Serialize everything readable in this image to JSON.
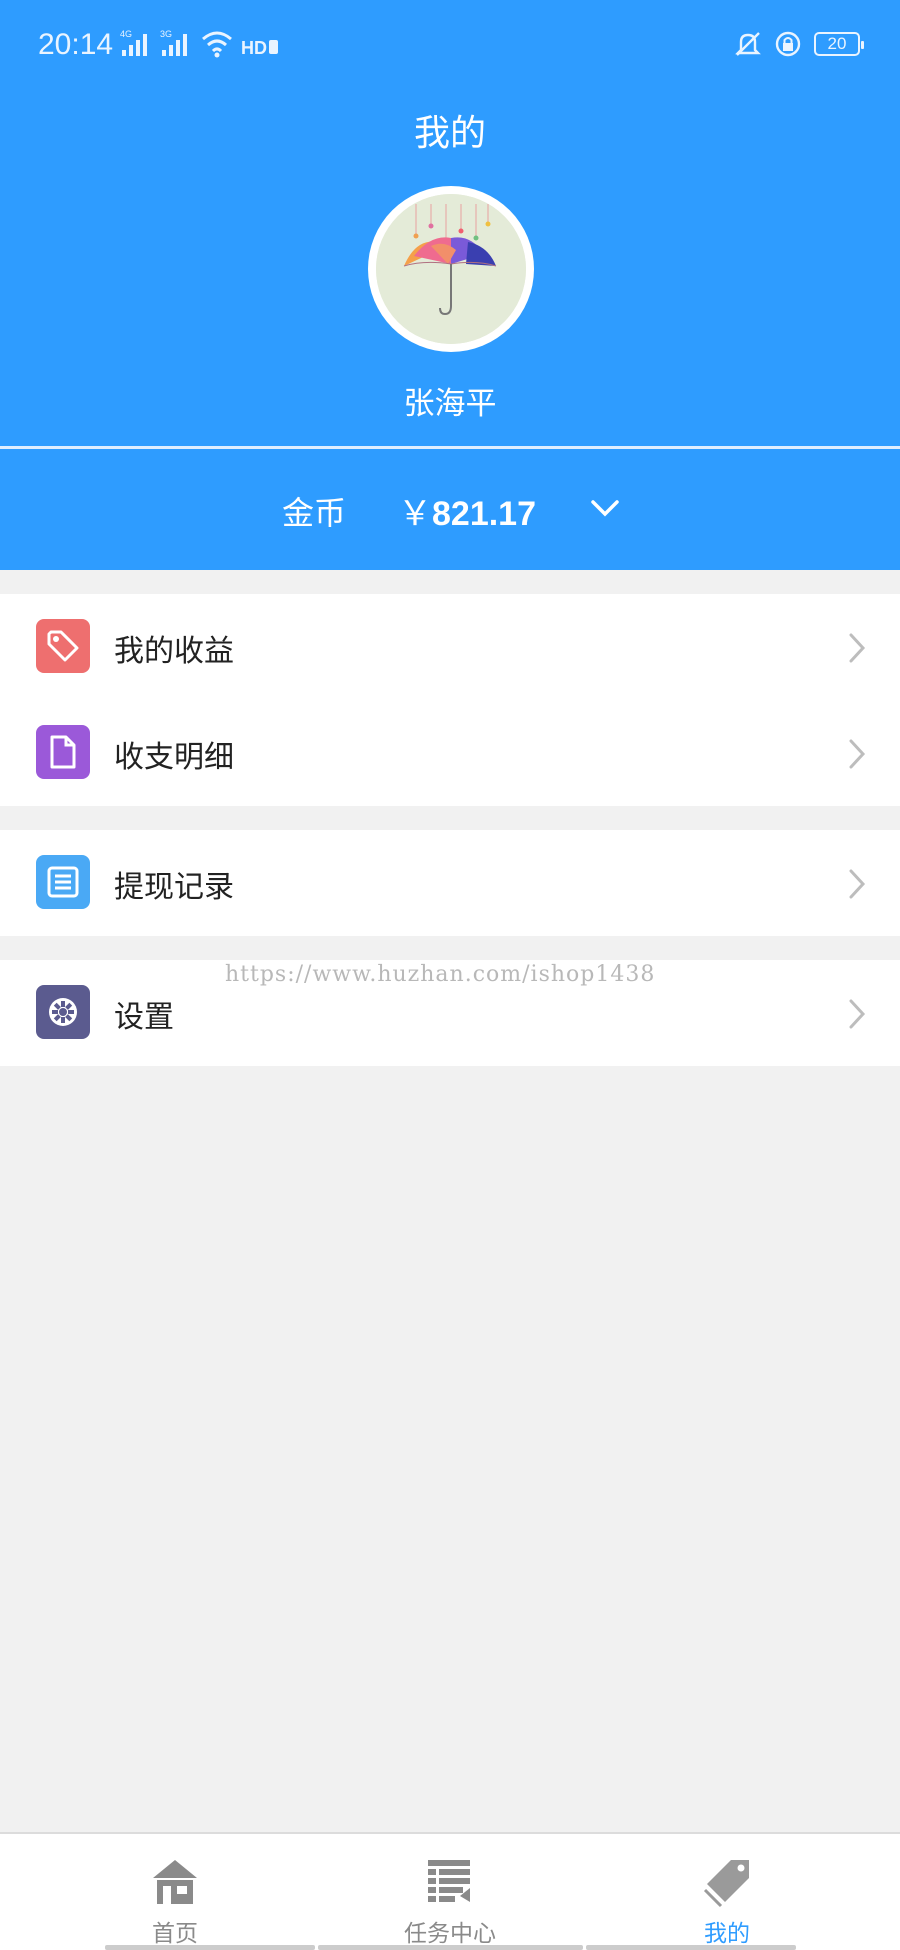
{
  "status_bar": {
    "time": "20:14",
    "signal1_label": "4G",
    "signal2_label": "3G",
    "hd_label": "HD",
    "battery": "20"
  },
  "header": {
    "title": "我的",
    "user_name": "张海平",
    "coins_label": "金币",
    "coins_currency": "￥",
    "coins_value": "821.17"
  },
  "menu": {
    "group1": [
      {
        "label": "我的收益",
        "icon": "tag-icon",
        "color": "#ee6f6f"
      },
      {
        "label": "收支明细",
        "icon": "document-icon",
        "color": "#9b59d9"
      }
    ],
    "group2": [
      {
        "label": "提现记录",
        "icon": "list-icon",
        "color": "#4aa9f5"
      }
    ],
    "group3": [
      {
        "label": "设置",
        "icon": "gear-icon",
        "color": "#5b5b8f"
      }
    ]
  },
  "watermark": "https://www.huzhan.com/ishop1438",
  "tabbar": {
    "tabs": [
      {
        "label": "首页",
        "icon": "home-icon"
      },
      {
        "label": "任务中心",
        "icon": "task-list-icon"
      },
      {
        "label": "我的",
        "icon": "tag-icon"
      }
    ],
    "active_index": 2
  },
  "colors": {
    "primary": "#2e9cff",
    "background": "#f1f1f1",
    "inactive_tab": "#8a8a8a"
  }
}
